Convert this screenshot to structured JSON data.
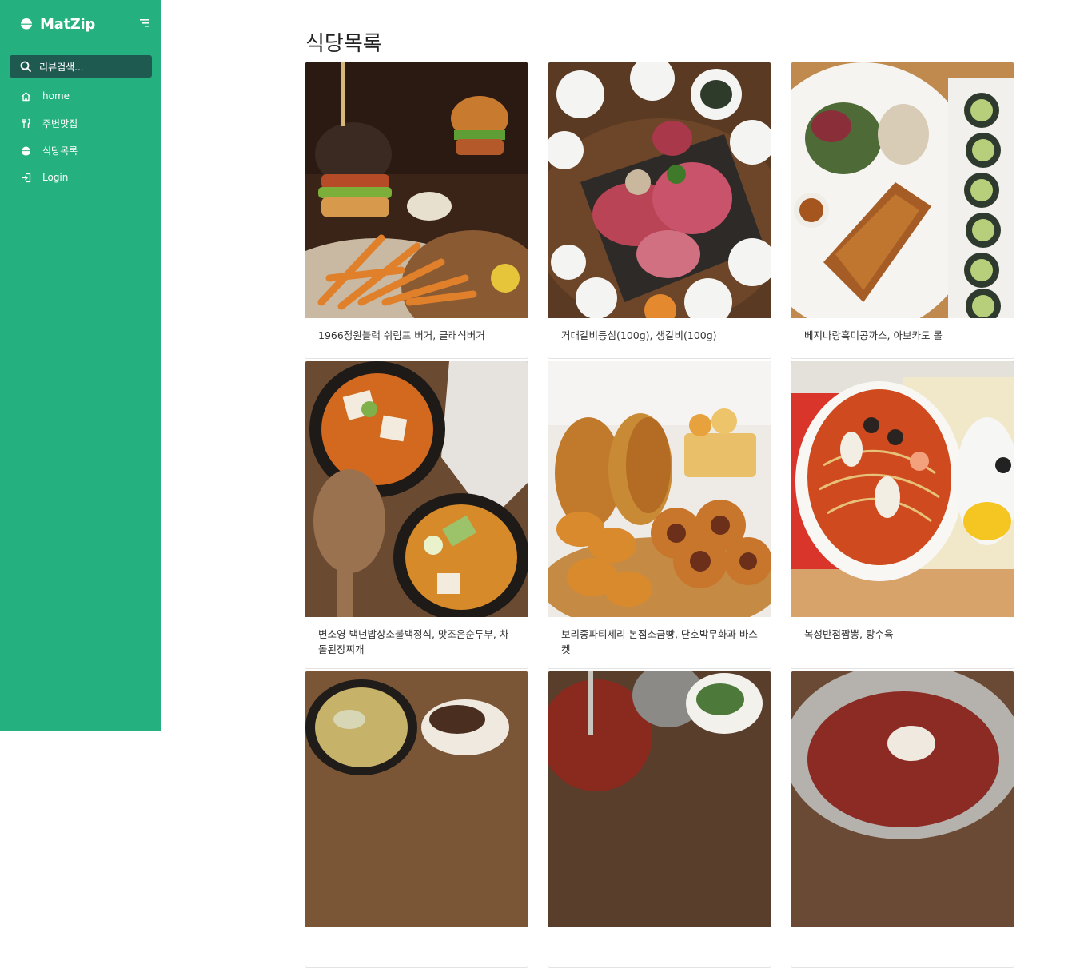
{
  "app": {
    "brand": "MatZip"
  },
  "sidebar": {
    "search_label": "리뷰검색...",
    "items": [
      {
        "label": "home",
        "icon": "home-icon"
      },
      {
        "label": "주변맛집",
        "icon": "utensils-icon"
      },
      {
        "label": "식당목록",
        "icon": "dumpling-icon"
      },
      {
        "label": "Login",
        "icon": "login-icon"
      }
    ]
  },
  "main": {
    "title": "식당목록",
    "cards": [
      {
        "caption": "1966정원블랙 쉬림프 버거, 클래식버거",
        "image": "burger-fries-photo"
      },
      {
        "caption": "거대갈비등심(100g), 생갈비(100g)",
        "image": "raw-beef-platter-photo"
      },
      {
        "caption": "베지나랑흑미콩까스, 아보카도 롤",
        "image": "cutlet-salad-roll-photo"
      },
      {
        "caption": "변소영 백년밥상소불백정식, 맛조은순두부, 차돌된장찌개",
        "image": "stew-pots-photo"
      },
      {
        "caption": "보리종파티세리 본점소금빵, 단호박무화과 바스켓",
        "image": "bread-bakery-photo"
      },
      {
        "caption": "복성반점짬뽕, 탕수육",
        "image": "jjamppong-bowl-photo"
      },
      {
        "caption": "",
        "image": "soup-bowl-photo"
      },
      {
        "caption": "",
        "image": "spicy-noodle-photo"
      },
      {
        "caption": "",
        "image": "cold-noodle-photo"
      }
    ]
  },
  "colors": {
    "sidebar_bg": "#25b17f",
    "search_bg": "#1f5a51",
    "text_primary": "#222222"
  }
}
